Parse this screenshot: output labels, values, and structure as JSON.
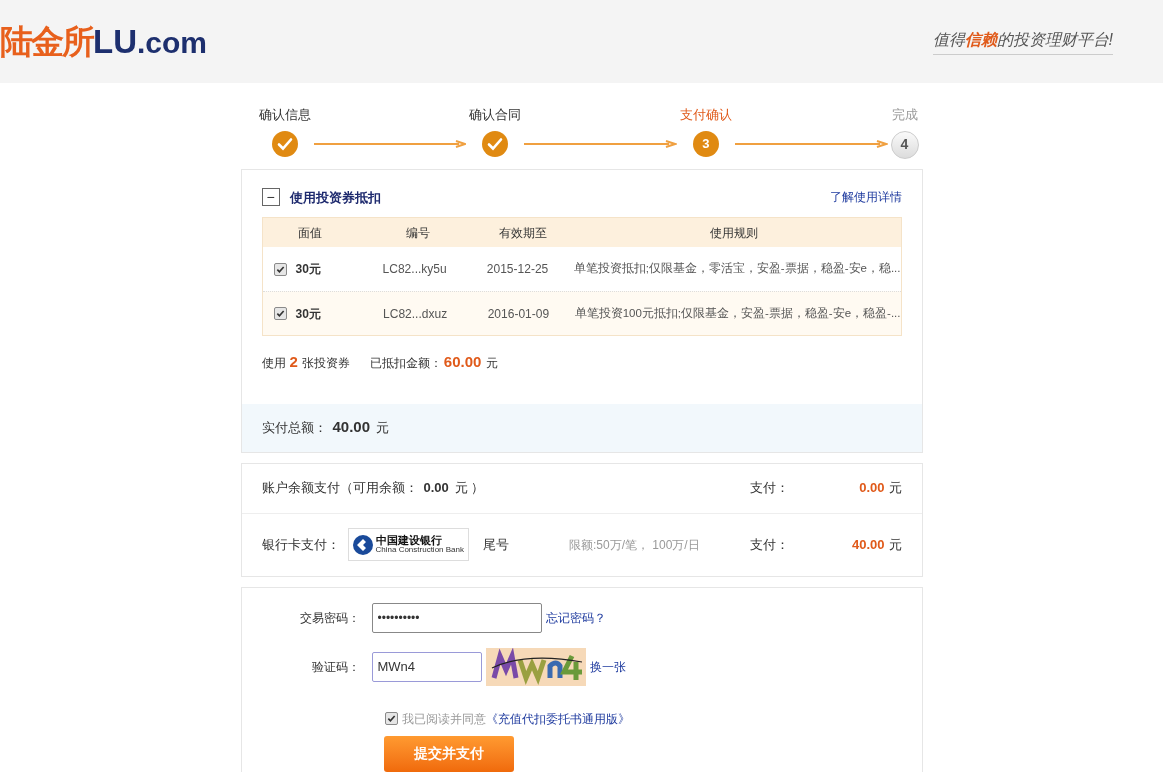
{
  "header": {
    "logo_cn": "陆金所",
    "logo_en": "LU",
    "logo_domain": ".com",
    "slogan": "值得**信赖**的投资理财平台!"
  },
  "steps": [
    {
      "label": "确认信息",
      "done": true,
      "current": false
    },
    {
      "label": "确认合同",
      "done": true,
      "current": false
    },
    {
      "label": "支付确认",
      "done": false,
      "current": true,
      "number": "3"
    },
    {
      "label": "完成",
      "done": false,
      "current": false,
      "number": "4"
    }
  ],
  "coupon": {
    "toggle": "−",
    "expanded": true,
    "title": "使用投资券抵扣",
    "link": "了解使用详情",
    "columns": [
      "面值",
      "编号",
      "有效期至",
      "使用规则"
    ],
    "rows": [
      {
        "checked": true,
        "highlighted": false,
        "value": "30元",
        "code": "LC82...ky5u",
        "expiry": "2015-12-25",
        "rule": "单笔投资抵扣;仅限基金，零活宝，安盈-票据，稳盈-安e，稳..."
      },
      {
        "checked": true,
        "highlighted": true,
        "value": "30元",
        "code": "LC82...dxuz",
        "expiry": "2016-01-09",
        "rule": "单笔投资100元抵扣;仅限基金，安盈-票据，稳盈-安e，稳盈-..."
      }
    ],
    "summary_prefix": "使用",
    "count": "2",
    "summary_suffix": "张投资券",
    "deducted_label": "已抵扣金额：",
    "deducted": "60.00",
    "deducted_unit": "元"
  },
  "total": {
    "label": "实付总额：",
    "amount": "40.00",
    "unit": "元"
  },
  "payment": [
    {
      "kind": "balance",
      "label": "账户余额支付（可用余额：",
      "balance": "0.00",
      "close": "元 ）",
      "pay_label": "支付：",
      "amount": "0.00",
      "unit": "元"
    },
    {
      "kind": "bank",
      "label": "银行卡支付：",
      "bank_cn": "中国建设银行",
      "bank_en": "China Construction Bank",
      "tail": "尾号",
      "limit": "限额:50万/笔， 100万/日",
      "pay_label": "支付：",
      "amount": "40.00",
      "unit": "元"
    }
  ],
  "form": {
    "password_label": "交易密码：",
    "password": "••••••••••",
    "forgot": "忘记密码？",
    "captcha_label": "验证码：",
    "captcha": "MWn4",
    "refresh": "换一张",
    "agree_checked": true,
    "agree_text": "我已阅读并同意",
    "agreement": "《充值代扣委托书通用版》",
    "submit": "提交并支付"
  }
}
